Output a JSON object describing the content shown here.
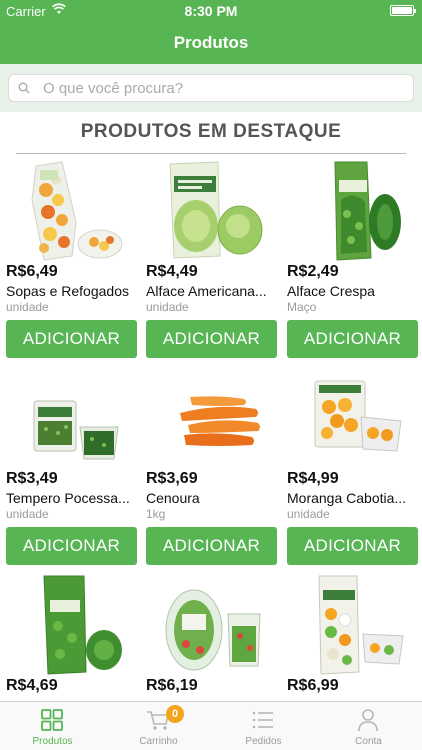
{
  "status_bar": {
    "carrier": "Carrier",
    "time": "8:30 PM"
  },
  "header": {
    "title": "Produtos"
  },
  "search": {
    "placeholder": "O que você procura?"
  },
  "section": {
    "title": "PRODUTOS EM DESTAQUE"
  },
  "products": [
    {
      "price": "R$6,49",
      "name": "Sopas e Refogados",
      "unit": "unidade",
      "button": "ADICIONAR"
    },
    {
      "price": "R$4,49",
      "name": "Alface Americana...",
      "unit": "unidade",
      "button": "ADICIONAR"
    },
    {
      "price": "R$2,49",
      "name": "Alface Crespa",
      "unit": "Maço",
      "button": "ADICIONAR"
    },
    {
      "price": "R$3,49",
      "name": "Tempero Pocessa...",
      "unit": "unidade",
      "button": "ADICIONAR"
    },
    {
      "price": "R$3,69",
      "name": "Cenoura",
      "unit": "1kg",
      "button": "ADICIONAR"
    },
    {
      "price": "R$4,99",
      "name": "Moranga Cabotia...",
      "unit": "unidade",
      "button": "ADICIONAR"
    },
    {
      "price": "R$4,69"
    },
    {
      "price": "R$6,19"
    },
    {
      "price": "R$6,99"
    }
  ],
  "tabs": [
    {
      "label": "Produtos",
      "icon": "grid-icon",
      "active": true
    },
    {
      "label": "Carrinho",
      "icon": "cart-icon",
      "badge": "0"
    },
    {
      "label": "Pedidos",
      "icon": "list-icon"
    },
    {
      "label": "Conta",
      "icon": "user-icon"
    }
  ],
  "colors": {
    "brand_green": "#57b553",
    "badge_orange": "#f4a41d",
    "muted": "#9b9b9b"
  }
}
